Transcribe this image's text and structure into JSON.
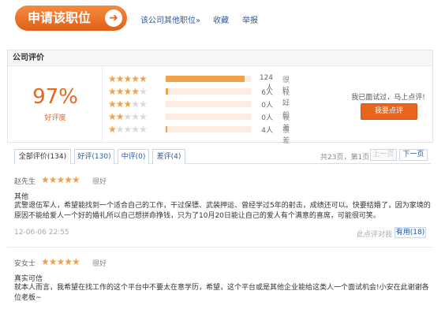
{
  "header": {
    "apply_label": "申请该职位",
    "links": [
      "该公司其他职位»",
      "收藏",
      "举报"
    ]
  },
  "company_review": {
    "title": "公司评价",
    "percent": "97%",
    "percent_label": "好评度",
    "rows": [
      {
        "stars": 5,
        "count": "124人",
        "level": "很好",
        "fraction": 0.93
      },
      {
        "stars": 4,
        "count": "6人",
        "level": "较好",
        "fraction": 0.03
      },
      {
        "stars": 3,
        "count": "0人",
        "level": "一般",
        "fraction": 0
      },
      {
        "stars": 2,
        "count": "0人",
        "level": "较差",
        "fraction": 0
      },
      {
        "stars": 1,
        "count": "4人",
        "level": "很差",
        "fraction": 0.02
      }
    ],
    "prompt": "我已面试过，马上点评!",
    "review_button": "我要点评"
  },
  "tabs": {
    "items": [
      "全部评价(134)",
      "好评(130)",
      "中评(0)",
      "差评(4)"
    ],
    "page_info": "共23页，第1页",
    "prev_label": "上一页",
    "next_label": "下一页"
  },
  "reviews": [
    {
      "name": "赵先生",
      "stars": 5,
      "level": "很好",
      "title": "其他",
      "body": "武警退伍军人，希望能找到一个适合自己的工作，干过保镖、武装押运、曾经学过5年的射击，成绩还可以。快要结婚了，因为家境的原因不能给爱人一个好的婚礼所以自己想拼命挣钱，只为了10月20日能让自己的爱人有个满意的喜席，可能很可笑。",
      "date": "12-06-06 22:55",
      "ask_label": "此点评对我",
      "useful_label": "有用(18)"
    },
    {
      "name": "安女士",
      "stars": 5,
      "level": "很好",
      "title": "真实可信",
      "body": "就本人而言，我希望在找工作的这个平台中不要太在意学历，希望，这个平台或是其他企业能给这类人一个面试机会!小安在此谢谢各位老板~"
    }
  ],
  "colors": {
    "accent": "#e8651e",
    "star": "#f0a14a",
    "link": "#2a5a9e"
  }
}
